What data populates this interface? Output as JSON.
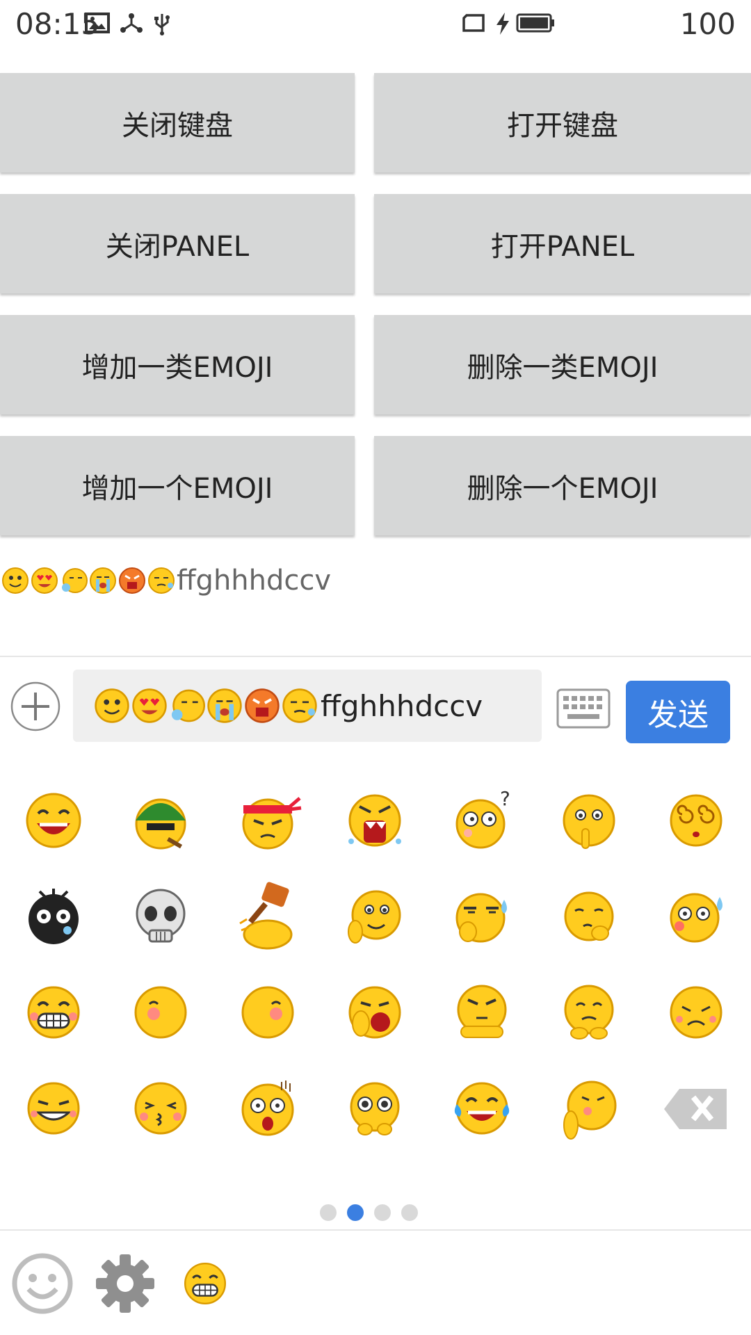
{
  "status_bar": {
    "time": "08:15",
    "battery": "100"
  },
  "buttons": {
    "close_keyboard": "关闭键盘",
    "open_keyboard": "打开键盘",
    "close_panel": "关闭PANEL",
    "open_panel": "打开PANEL",
    "add_emoji_category": "增加一类EMOJI",
    "remove_emoji_category": "删除一类EMOJI",
    "add_emoji": "增加一个EMOJI",
    "remove_emoji": "删除一个EMOJI"
  },
  "preview": {
    "text": "ffghhhdccv"
  },
  "input": {
    "value": "ffghhhdccv",
    "send_label": "发送"
  },
  "pager": {
    "pages": 4,
    "active": 2
  },
  "colors": {
    "accent": "#3b7fe1",
    "button_bg": "#d6d7d7",
    "emoji_yellow": "#ffcc1f"
  }
}
